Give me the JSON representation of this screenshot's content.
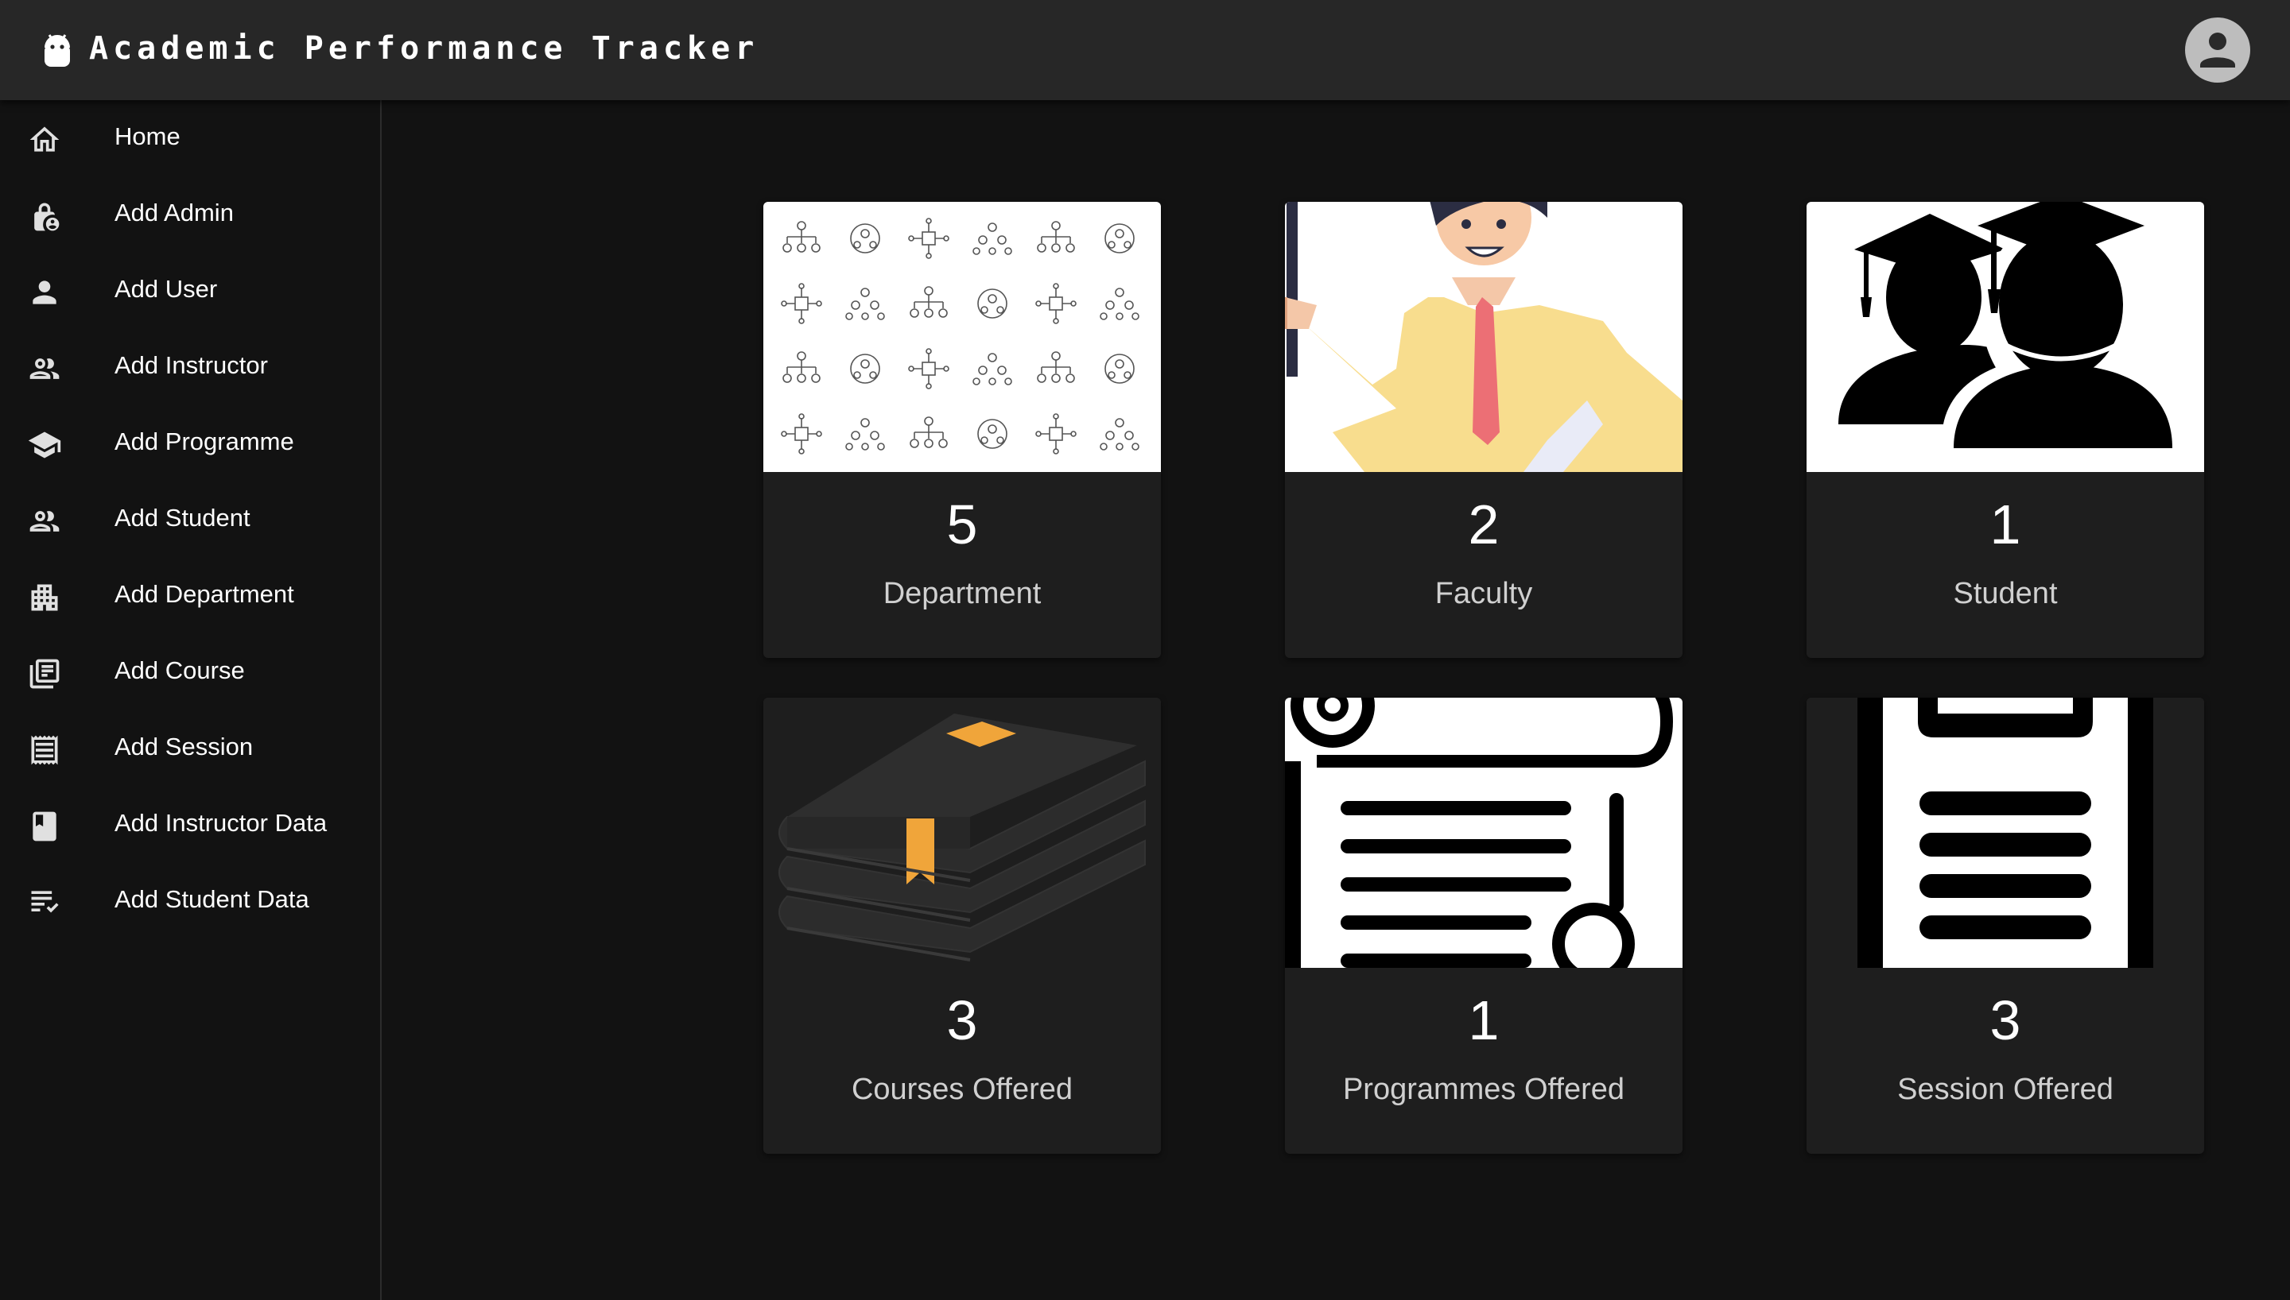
{
  "app": {
    "title": "Academic Performance Tracker",
    "logo_icon": "android-icon",
    "account_icon": "account-circle-icon"
  },
  "sidebar": {
    "items": [
      {
        "label": "Home",
        "icon": "home-icon"
      },
      {
        "label": "Add Admin",
        "icon": "admin-lock-icon"
      },
      {
        "label": "Add User",
        "icon": "person-icon"
      },
      {
        "label": "Add Instructor",
        "icon": "people-icon"
      },
      {
        "label": "Add Programme",
        "icon": "school-icon"
      },
      {
        "label": "Add Student",
        "icon": "people-icon"
      },
      {
        "label": "Add Department",
        "icon": "building-icon"
      },
      {
        "label": "Add Course",
        "icon": "library-books-icon"
      },
      {
        "label": "Add Session",
        "icon": "receipt-icon"
      },
      {
        "label": "Add Instructor Data",
        "icon": "book-icon"
      },
      {
        "label": "Add Student Data",
        "icon": "checklist-icon"
      }
    ]
  },
  "cards": [
    {
      "count": "5",
      "label": "Department",
      "image": "department-image"
    },
    {
      "count": "2",
      "label": "Faculty",
      "image": "faculty-image"
    },
    {
      "count": "1",
      "label": "Student",
      "image": "student-image"
    },
    {
      "count": "3",
      "label": "Courses Offered",
      "image": "courses-image"
    },
    {
      "count": "1",
      "label": "Programmes Offered",
      "image": "programmes-image"
    },
    {
      "count": "3",
      "label": "Session Offered",
      "image": "session-image"
    }
  ],
  "colors": {
    "background": "#121212",
    "appbar": "#272727",
    "card": "#1e1e1e",
    "accent": "#f0a53a"
  }
}
